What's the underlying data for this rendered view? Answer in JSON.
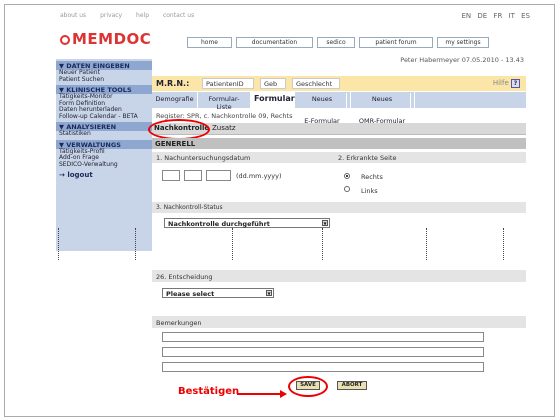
{
  "topbar": {
    "links": [
      "about us",
      "privacy",
      "help",
      "contact us"
    ],
    "languages": [
      "EN",
      "DE",
      "FR",
      "IT",
      "ES"
    ]
  },
  "logo": "MEMDOC",
  "nav": [
    "home",
    "documentation",
    "sedico",
    "patient forum",
    "my settings"
  ],
  "user_line": "Peter Habermeyer   07.05.2010 - 13.43",
  "sidebar": {
    "s1_header": "DATEN EINGEBEN",
    "s1_items": [
      "Neuer Patient",
      "Patient Suchen"
    ],
    "s2_header": "KLINISCHE TOOLS",
    "s2_items": [
      "Tätigkeits-Monitor",
      "Form Definition",
      "Daten herunterladen",
      "Follow-up Calendar - BETA"
    ],
    "s3_header": "ANALYSIEREN",
    "s3_items": [
      "Statistiken"
    ],
    "s4_header": "VERWALTUNGS",
    "s4_items": [
      "Tätigkeits-Profil",
      "Add-on Frage",
      "SEDICO-Verwaltung"
    ],
    "logout": "logout"
  },
  "mrn": {
    "label": "M.R.N.:",
    "patient_id": "PatientenID",
    "geb": "Geb",
    "geschlecht": "Geschlecht",
    "hilfe": "Hilfe",
    "hilfe_icon": "?"
  },
  "tabs": {
    "t1": "Demografie",
    "t2": "Formular-Liste",
    "t3": "Formular",
    "t4a": "Neues",
    "t4b": "E-Formular",
    "t5a": "Neues",
    "t5b": "OMR-Formular"
  },
  "register": "Register: SPR, c. Nachkontrolle 09, Rechts",
  "subtabs": {
    "a": "Nachkontrolle",
    "b": "Zusatz"
  },
  "form": {
    "section": "GENERELL",
    "q1": "1. Nachuntersuchungsdatum",
    "date_hint": "(dd.mm.yyyy)",
    "q2": "2. Erkrankte Seite",
    "opt_right": "Rechts",
    "opt_left": "Links",
    "q3": "3. Nachkontroll-Status",
    "status_value": "Nachkontrolle durchgeführt",
    "q26": "26. Entscheidung",
    "decision_value": "Please select",
    "remarks": "Bemerkungen"
  },
  "buttons": {
    "save": "SAVE",
    "abort": "ABORT"
  },
  "annotation": "Bestätigen"
}
